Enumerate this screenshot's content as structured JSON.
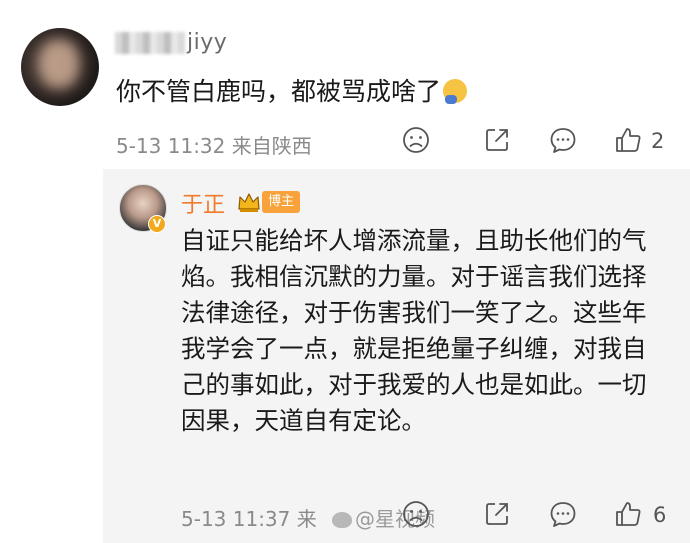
{
  "comment": {
    "username_visible": "jiyy",
    "text": "你不管白鹿吗，都被骂成啥了",
    "emoji_icon": "facepalm-emoji-icon",
    "meta": "5-13 11:32  来自陕西",
    "like_count": "2"
  },
  "reply": {
    "author": "于正",
    "role_badge": "博主",
    "verified_badge": "V",
    "text": "自证只能给坏人增添流量，且助长他们的气焰。我相信沉默的力量。对于谣言我们选择法律途径，对于伤害我们一笑了之。这些年我学会了一点，就是拒绝量子纠缠，对我自己的事如此，对于我爱的人也是如此。一切因果，天道自有定论。",
    "meta": "5-13 11:37  来",
    "like_count": "6"
  },
  "watermark": "@星视频",
  "colors": {
    "author": "#f07a2a",
    "badge": "#f7a23b",
    "reply_background": "#f4f4f4",
    "meta": "#8a8a8a"
  }
}
